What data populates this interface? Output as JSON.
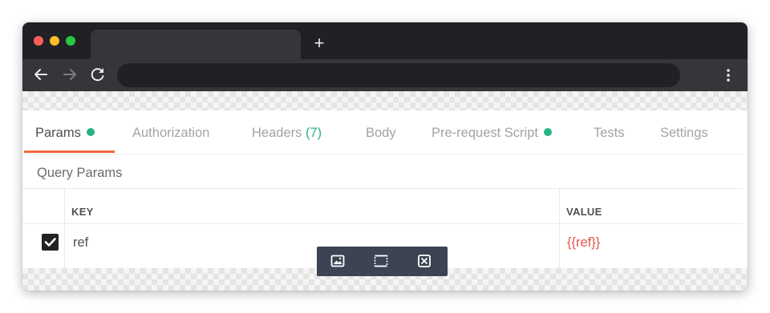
{
  "browser": {
    "new_tab_symbol": "+"
  },
  "request_tabs": [
    {
      "label": "Params",
      "count": "",
      "dot": true,
      "active": true
    },
    {
      "label": "Authorization",
      "count": "",
      "dot": false,
      "active": false
    },
    {
      "label": "Headers",
      "count": "(7)",
      "dot": false,
      "active": false
    },
    {
      "label": "Body",
      "count": "",
      "dot": false,
      "active": false
    },
    {
      "label": "Pre-request Script",
      "count": "",
      "dot": true,
      "active": false
    },
    {
      "label": "Tests",
      "count": "",
      "dot": false,
      "active": false
    },
    {
      "label": "Settings",
      "count": "",
      "dot": false,
      "active": false
    }
  ],
  "query_params": {
    "title": "Query Params",
    "headers": {
      "key": "KEY",
      "value": "VALUE"
    },
    "rows": [
      {
        "checked": true,
        "key": "ref",
        "value": "{{ref}}"
      }
    ]
  },
  "image_toolbar": {
    "buttons": [
      "image-icon",
      "fit-frame-icon",
      "close-box-icon"
    ]
  },
  "colors": {
    "accent_underline": "#f26b3a",
    "status_dot": "#26b47f",
    "variable_text": "#e0544a",
    "toolbar_bg": "#3c4453"
  }
}
